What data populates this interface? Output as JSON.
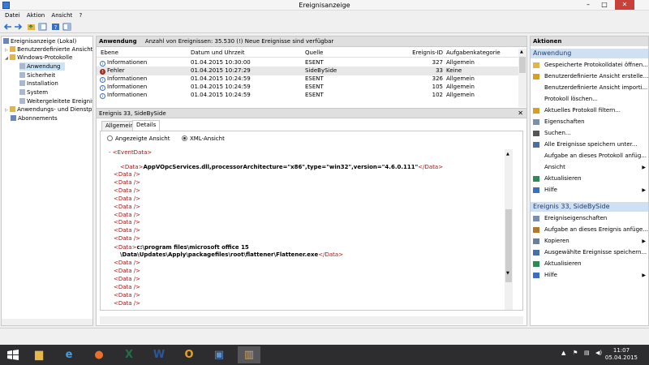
{
  "window": {
    "title": "Ereignisanzeige",
    "minimize": "–",
    "maximize": "□",
    "close": "✕"
  },
  "menu": [
    "Datei",
    "Aktion",
    "Ansicht",
    "?"
  ],
  "tree": [
    {
      "label": "Ereignisanzeige (Lokal)",
      "level": 0
    },
    {
      "label": "Benutzerdefinierte Ansichten",
      "level": 1
    },
    {
      "label": "Windows-Protokolle",
      "level": 1
    },
    {
      "label": "Anwendung",
      "level": 2,
      "selected": true
    },
    {
      "label": "Sicherheit",
      "level": 2
    },
    {
      "label": "Installation",
      "level": 2
    },
    {
      "label": "System",
      "level": 2
    },
    {
      "label": "Weitergeleitete Ereignisse",
      "level": 2
    },
    {
      "label": "Anwendungs- und Dienstprotokolle",
      "level": 1
    },
    {
      "label": "Abonnements",
      "level": 1
    }
  ],
  "center": {
    "title": "Anwendung",
    "info": "Anzahl von Ereignissen: 35.530 (!) Neue Ereignisse sind verfügbar"
  },
  "columns": [
    "Ebene",
    "Datum und Uhrzeit",
    "Quelle",
    "Ereignis-ID",
    "Aufgabenkategorie"
  ],
  "events": [
    {
      "level": "Informationen",
      "type": "info",
      "date": "01.04.2015 10:30:00",
      "source": "ESENT",
      "id": "327",
      "category": "Allgemein"
    },
    {
      "level": "Fehler",
      "type": "error",
      "date": "01.04.2015 10:27:29",
      "source": "SideBySide",
      "id": "33",
      "category": "Keine"
    },
    {
      "level": "Informationen",
      "type": "info",
      "date": "01.04.2015 10:24:59",
      "source": "ESENT",
      "id": "326",
      "category": "Allgemein"
    },
    {
      "level": "Informationen",
      "type": "info",
      "date": "01.04.2015 10:24:59",
      "source": "ESENT",
      "id": "105",
      "category": "Allgemein"
    },
    {
      "level": "Informationen",
      "type": "info",
      "date": "01.04.2015 10:24:59",
      "source": "ESENT",
      "id": "102",
      "category": "Allgemein"
    }
  ],
  "detail": {
    "title": "Ereignis 33, SideBySide",
    "close": "✕",
    "tabs": [
      "Allgemein",
      "Details"
    ],
    "radio_friendly": "Angezeigte Ansicht",
    "radio_xml": "XML-Ansicht",
    "xml": {
      "eventdata_open": "<EventData>",
      "open": "<Data>",
      "close": "</Data>",
      "empty": "<Data />",
      "value1": "AppVOpcServices.dll,processorArchitecture=\"x86\",type=\"win32\",version=\"4.6.0.111\"",
      "value2a": "c:\\program files\\microsoft office 15",
      "value2b": "\\Data\\Updates\\Apply\\packagefiles\\root\\flattener\\Flattener.exe"
    }
  },
  "actions": {
    "header": "Aktionen",
    "section1": "Anwendung",
    "items1": [
      {
        "label": "Gespeicherte Protokolldatei öffnen...",
        "icon": "folder-icon",
        "color": "#e0b64a"
      },
      {
        "label": "Benutzerdefinierte Ansicht erstelle...",
        "icon": "filter-icon",
        "color": "#d8a020"
      },
      {
        "label": "Benutzerdefinierte Ansicht importi...",
        "icon": "blank-icon",
        "color": ""
      },
      {
        "label": "Protokoll löschen...",
        "icon": "blank-icon",
        "color": ""
      },
      {
        "label": "Aktuelles Protokoll filtern...",
        "icon": "filter-icon",
        "color": "#d8a020"
      },
      {
        "label": "Eigenschaften",
        "icon": "properties-icon",
        "color": "#7a8fb0"
      },
      {
        "label": "Suchen...",
        "icon": "binoculars-icon",
        "color": "#555555"
      },
      {
        "label": "Alle Ereignisse speichern unter...",
        "icon": "save-icon",
        "color": "#4a6fa5"
      },
      {
        "label": "Aufgabe an dieses Protokoll anfüg...",
        "icon": "blank-icon",
        "color": ""
      },
      {
        "label": "Ansicht",
        "icon": "blank-icon",
        "color": "",
        "submenu": true
      },
      {
        "label": "Aktualisieren",
        "icon": "refresh-icon",
        "color": "#2e8b57"
      },
      {
        "label": "Hilfe",
        "icon": "help-icon",
        "color": "#3a6fc4",
        "submenu": true
      }
    ],
    "section2": "Ereignis 33, SideBySide",
    "items2": [
      {
        "label": "Ereigniseigenschaften",
        "icon": "properties-icon",
        "color": "#7a8fb0"
      },
      {
        "label": "Aufgabe an dieses Ereignis anfüge...",
        "icon": "task-icon",
        "color": "#b07a2a"
      },
      {
        "label": "Kopieren",
        "icon": "copy-icon",
        "color": "#6a7f9a",
        "submenu": true
      },
      {
        "label": "Ausgewählte Ereignisse speichern...",
        "icon": "save-icon",
        "color": "#4a6fa5"
      },
      {
        "label": "Aktualisieren",
        "icon": "refresh-icon",
        "color": "#2e8b57"
      },
      {
        "label": "Hilfe",
        "icon": "help-icon",
        "color": "#3a6fc4",
        "submenu": true
      }
    ],
    "submenu_arrow": "▶"
  },
  "taskbar": {
    "start_icon": "windows-logo-icon",
    "apps": [
      {
        "name": "explorer-icon",
        "glyph": "▆",
        "color": "#e6b84a"
      },
      {
        "name": "internet-explorer-icon",
        "glyph": "e",
        "color": "#3fa0e8"
      },
      {
        "name": "firefox-icon",
        "glyph": "●",
        "color": "#e8702a"
      },
      {
        "name": "excel-icon",
        "glyph": "X",
        "color": "#1e7145"
      },
      {
        "name": "word-icon",
        "glyph": "W",
        "color": "#2b579a"
      },
      {
        "name": "outlook-icon",
        "glyph": "O",
        "color": "#e8a317"
      },
      {
        "name": "remote-desktop-icon",
        "glyph": "▣",
        "color": "#5a8fd0"
      },
      {
        "name": "event-viewer-icon",
        "glyph": "▥",
        "color": "#c9a46a"
      }
    ],
    "time": "11:07",
    "date": "05.04.2015"
  }
}
